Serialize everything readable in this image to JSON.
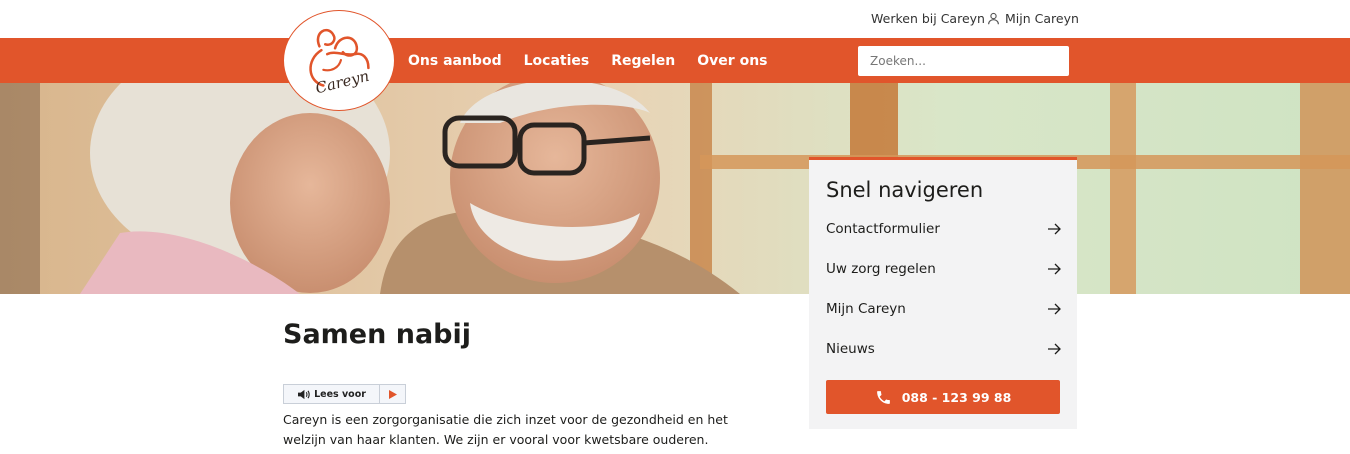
{
  "header": {
    "links": {
      "werken": "Werken bij Careyn",
      "mijn": "Mijn Careyn"
    },
    "logo_text": "Careyn",
    "nav": [
      "Ons aanbod",
      "Locaties",
      "Regelen",
      "Over ons"
    ],
    "search": {
      "placeholder": "Zoeken..."
    }
  },
  "quicknav": {
    "title": "Snel navigeren",
    "links": [
      "Contactformulier",
      "Uw zorg regelen",
      "Mijn Careyn",
      "Nieuws"
    ],
    "phone": "088 - 123 99 88"
  },
  "main": {
    "title": "Samen nabij",
    "readspeaker_label": "Lees voor",
    "intro": "Careyn is een zorgorganisatie die zich inzet voor de gezondheid en het welzijn van haar klanten. We zijn er vooral voor kwetsbare ouderen. Zowel thuis als in onze"
  },
  "colors": {
    "brand": "#e1552b",
    "panel_bg": "#f3f3f4",
    "text": "#1d1d1b"
  },
  "icons": [
    "user-icon",
    "arrow-right-icon",
    "phone-icon",
    "speaker-icon",
    "play-icon",
    "careyn-logo"
  ]
}
